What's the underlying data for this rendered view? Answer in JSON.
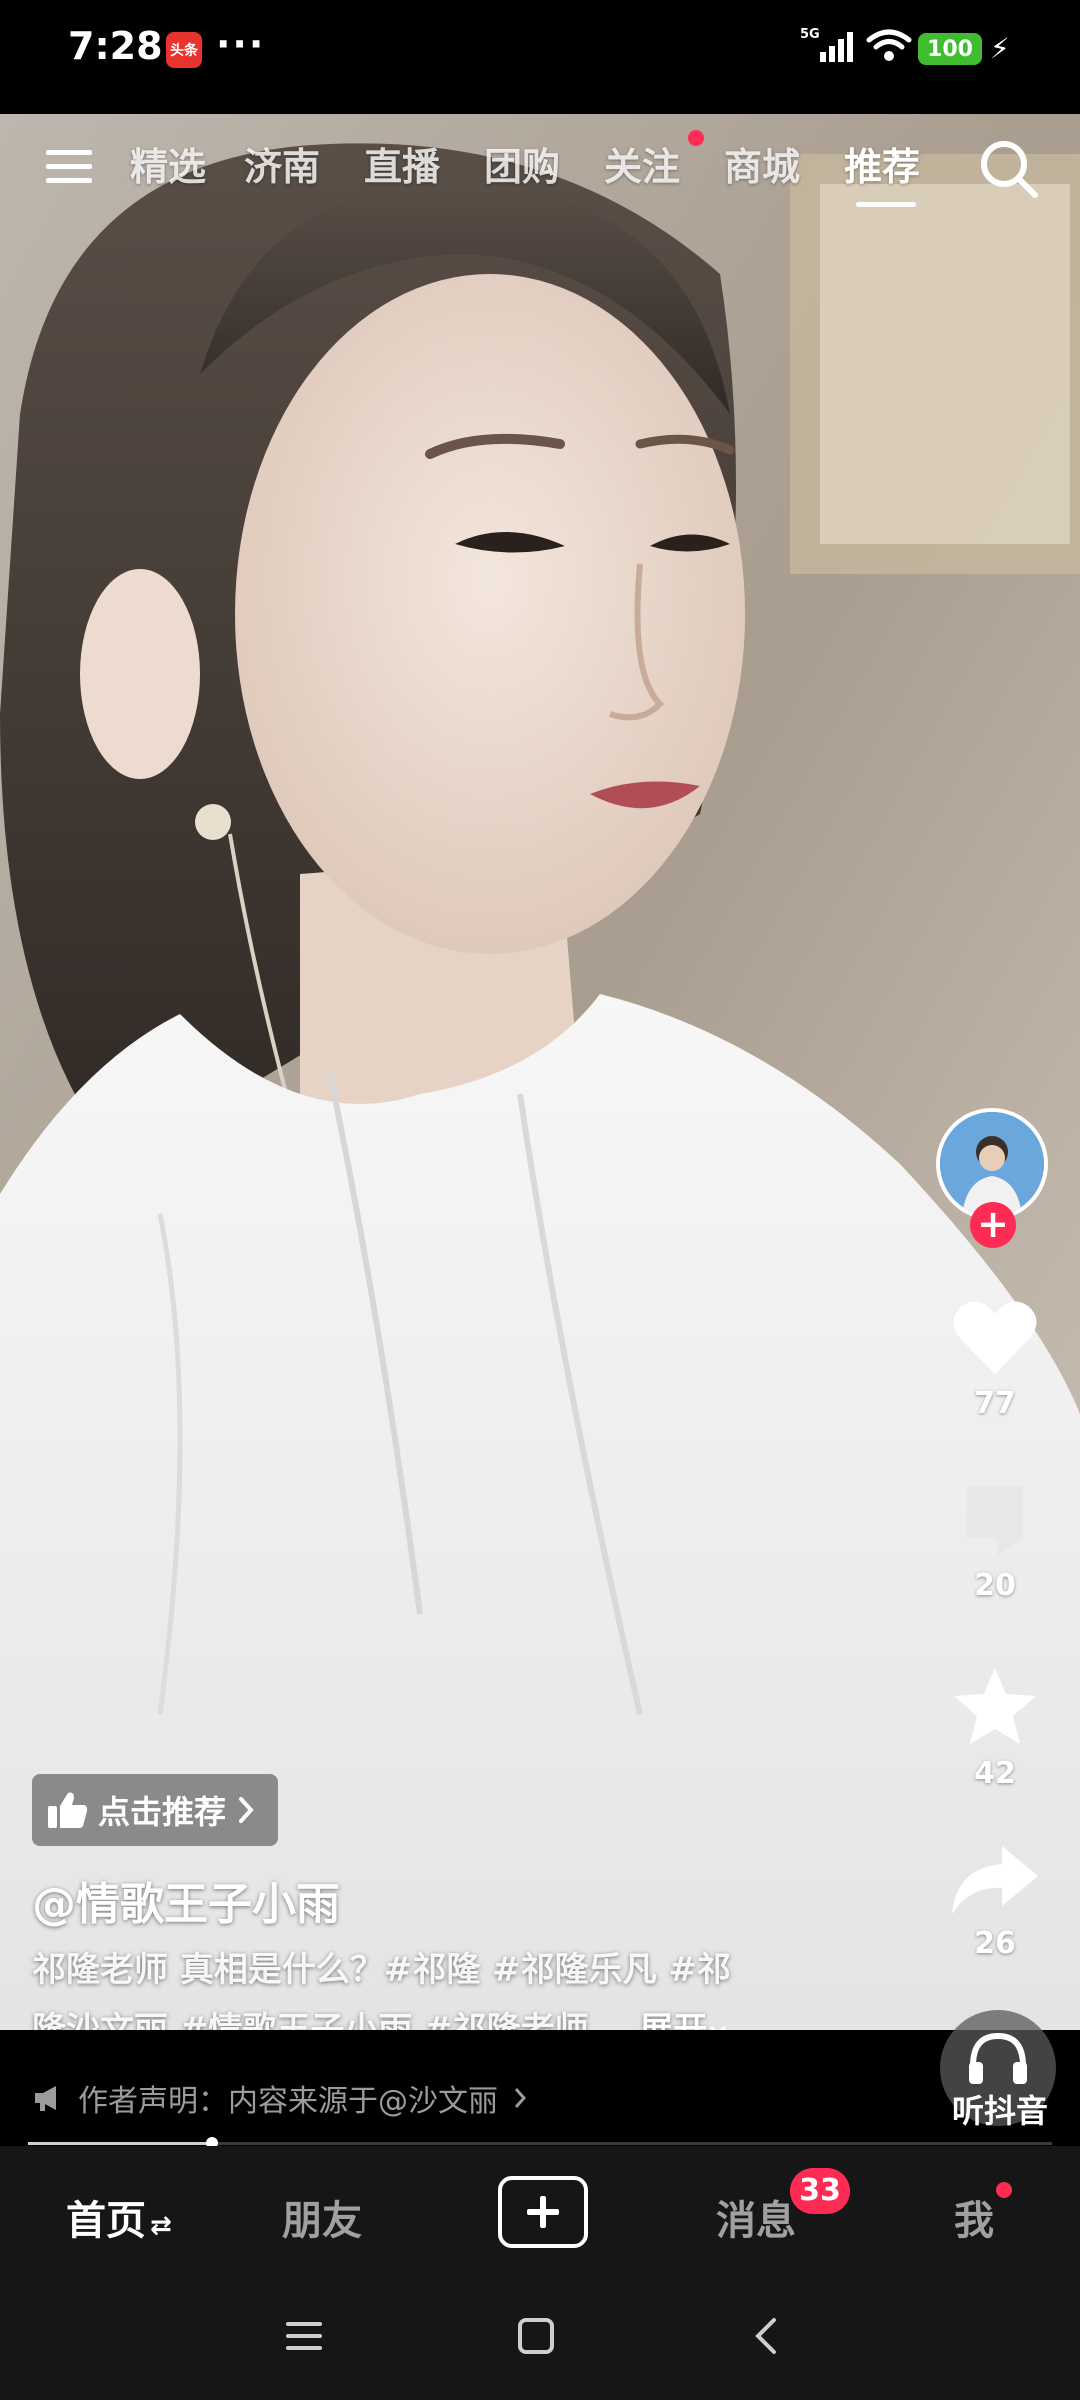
{
  "status": {
    "time": "7:28",
    "app_badge": "头条",
    "dots": "···",
    "network": "5G",
    "battery": "100"
  },
  "top_nav": {
    "tabs": [
      "精选",
      "济南",
      "直播",
      "团购",
      "关注",
      "商城",
      "推荐"
    ],
    "active_tab": "推荐"
  },
  "side_rail": {
    "like_count": "77",
    "comment_count": "20",
    "favorite_count": "42",
    "share_count": "26"
  },
  "video_info": {
    "recommend_label": "点击推荐",
    "author": "@情歌王子小雨",
    "caption_line1": "祁隆老师 真相是什么？#祁隆 #祁隆乐凡 #祁",
    "caption_line2": "隆沙文丽 #情歌王子小雨 #祁隆老师...",
    "expand_label": "展开",
    "disclaimer": "作者声明：内容来源于@沙文丽",
    "progress": 0.18
  },
  "listen": {
    "label": "听抖音"
  },
  "bottom_tabs": {
    "home": "首页",
    "friends": "朋友",
    "messages": "消息",
    "messages_badge": "33",
    "me": "我"
  },
  "colors": {
    "accent": "#fe2c55",
    "tab_bar_bg": "#161616"
  }
}
